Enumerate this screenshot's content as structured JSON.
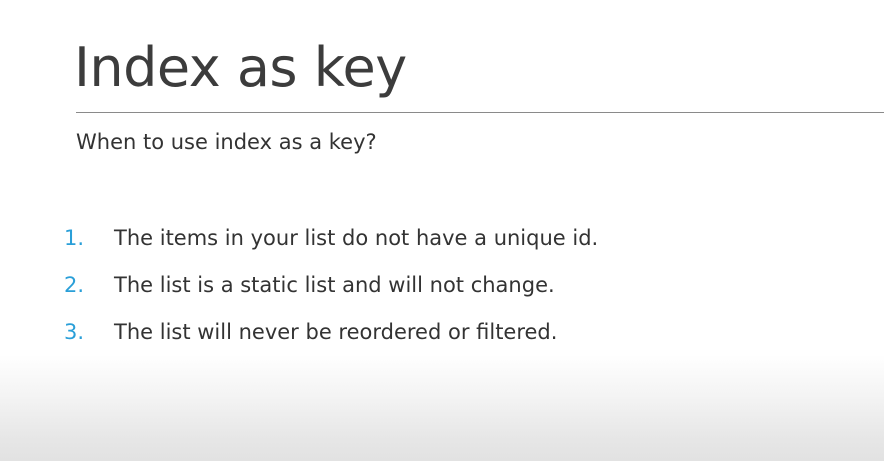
{
  "slide": {
    "title": "Index as key",
    "subtitle": "When to use index as a key?",
    "points": [
      {
        "number": "1.",
        "text": "The items in your list do not have a unique id."
      },
      {
        "number": "2.",
        "text": "The list is a static list and will not change."
      },
      {
        "number": "3.",
        "text": "The list will never be reordered or filtered."
      }
    ]
  },
  "colors": {
    "title_text": "#3c3c3c",
    "body_text": "#333333",
    "accent_numbers": "#2a9fd8",
    "rule": "#8a8a8a",
    "background_bottom": "#e2e2e2"
  }
}
